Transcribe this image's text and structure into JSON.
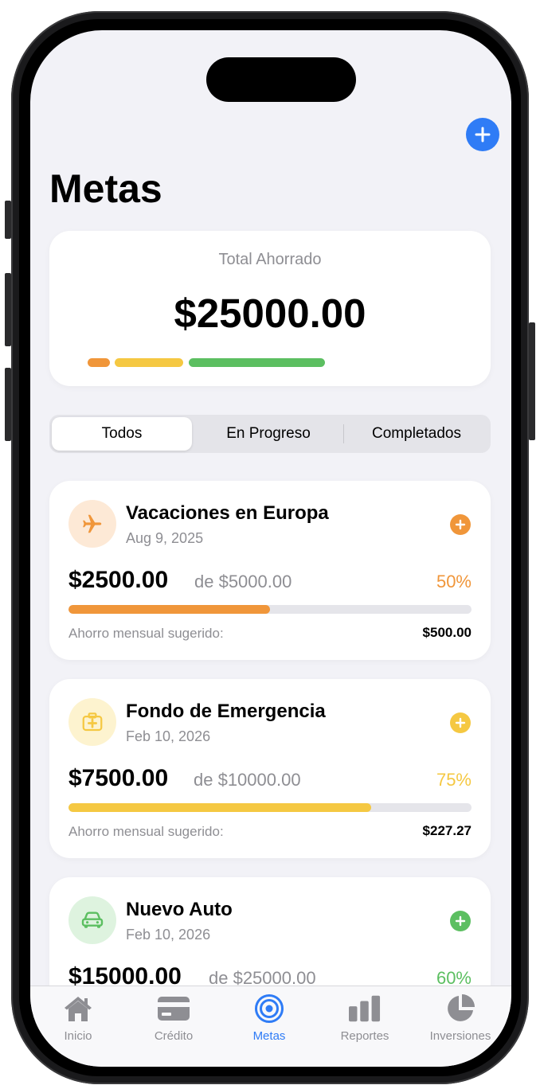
{
  "header": {
    "title": "Metas"
  },
  "summary": {
    "label": "Total Ahorrado",
    "amount": "$25000.00",
    "colors": [
      "#f0963a",
      "#f5c842",
      "#5cbf61"
    ]
  },
  "filter": {
    "options": [
      "Todos",
      "En Progreso",
      "Completados"
    ],
    "selected": "Todos"
  },
  "goals": [
    {
      "name": "Vacaciones en Europa",
      "date": "Aug 9, 2025",
      "saved": "$2500.00",
      "target": "de $5000.00",
      "percent_label": "50%",
      "progress": 0.5,
      "suggest_label": "Ahorro mensual sugerido:",
      "suggest_value": "$500.00",
      "icon": "airplane-icon",
      "color": "#f0963a",
      "icon_bg": "#fde9d6"
    },
    {
      "name": "Fondo de Emergencia",
      "date": "Feb 10, 2026",
      "saved": "$7500.00",
      "target": "de $10000.00",
      "percent_label": "75%",
      "progress": 0.75,
      "suggest_label": "Ahorro mensual sugerido:",
      "suggest_value": "$227.27",
      "icon": "first-aid-kit-icon",
      "color": "#f5c842",
      "icon_bg": "#fdf3cf"
    },
    {
      "name": "Nuevo Auto",
      "date": "Feb 10, 2026",
      "saved": "$15000.00",
      "target": "de $25000.00",
      "percent_label": "60%",
      "progress": 0.6,
      "suggest_label": "",
      "suggest_value": "",
      "icon": "car-icon",
      "color": "#5cbf61",
      "icon_bg": "#def3df"
    }
  ],
  "tabbar": {
    "items": [
      {
        "label": "Inicio",
        "icon": "house-icon"
      },
      {
        "label": "Crédito",
        "icon": "credit-card-icon"
      },
      {
        "label": "Metas",
        "icon": "target-icon"
      },
      {
        "label": "Reportes",
        "icon": "bar-chart-icon"
      },
      {
        "label": "Inversiones",
        "icon": "pie-chart-icon"
      }
    ],
    "active": "Metas",
    "active_color": "#2f7cf6"
  }
}
